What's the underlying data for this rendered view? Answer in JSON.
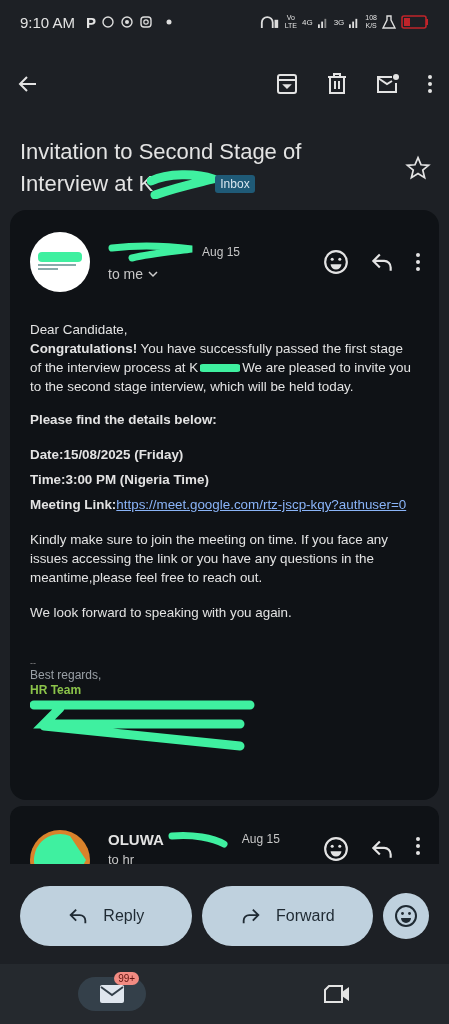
{
  "status_bar": {
    "time": "9:10 AM",
    "app_letter": "P",
    "volte_top": "Vo",
    "volte_bottom": "LTE",
    "net_4g": "4G",
    "net_3g": "3G",
    "speed_value": "108",
    "speed_unit": "K/S"
  },
  "subject": {
    "title_line_1": "Invitation to Second Stage of",
    "title_line_2": "Interview at K",
    "label": "Inbox",
    "starred": false
  },
  "message": {
    "date": "Aug 15",
    "recipient": "to me",
    "greeting": "Dear Candidate,",
    "intro_bold": "Congratulations!",
    "intro_line_1": " You have successfully passed the first stage",
    "intro_line_2": "of the interview process at K",
    "intro_line_2_after": "We are pleased to invite you",
    "intro_line_3": "to the second stage interview, which will be held today.",
    "details_heading": "Please find the details below:",
    "details": [
      {
        "label": "Date:",
        "value": "15/08/2025 (Friday)",
        "kind": "text"
      },
      {
        "label": "Time:",
        "value": "3:00 PM (Nigeria Time)",
        "kind": "text"
      },
      {
        "label": "Meeting Link:",
        "value": "https://meet.google.com/rtz-jscp-kqy?authuser=0",
        "kind": "link"
      }
    ],
    "paragraphs": [
      "Kindly make sure to join the meeting on time. If you face any issues accessing the link or you have any questions in the meantime,please feel free to reach out.",
      "We look forward to speaking with you again."
    ],
    "signature_dash": "--",
    "signature_closing": "Best regards,",
    "signature_team": "HR Team"
  },
  "second_message": {
    "sender": "OLUWA",
    "date": "Aug 15",
    "recipient": "to hr"
  },
  "actions": [
    {
      "label": "Reply",
      "kind": "reply"
    },
    {
      "label": "Forward",
      "kind": "forward"
    }
  ],
  "nav": [
    {
      "kind": "mail",
      "badge": "99+",
      "selected": true
    },
    {
      "kind": "video",
      "selected": false
    }
  ]
}
